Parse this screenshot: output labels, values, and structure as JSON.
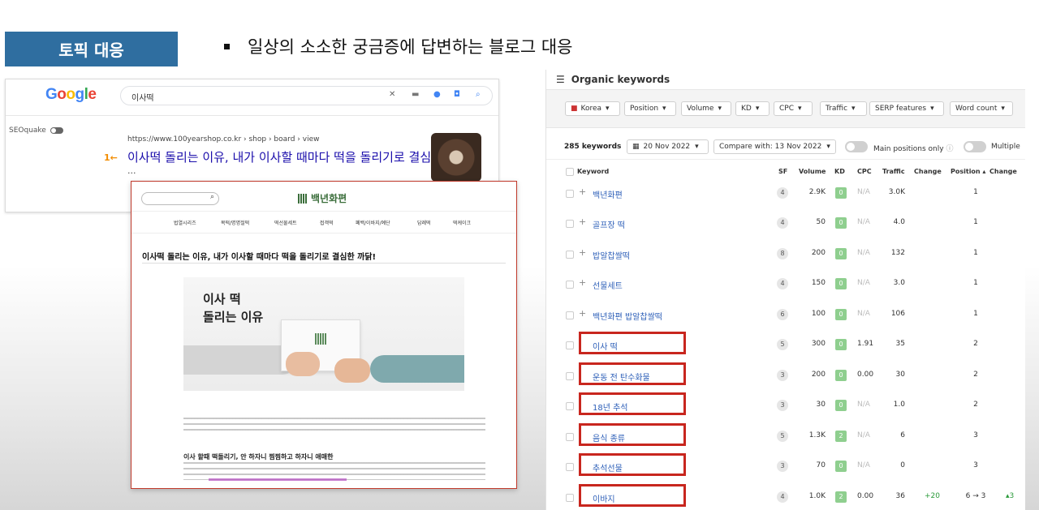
{
  "slide": {
    "topic_tag": "토픽 대응",
    "bullet": "일상의 소소한 궁금증에 답변하는 블로그 대응"
  },
  "google": {
    "logo": "Google",
    "query": "이사떡",
    "seoquake_label": "SEOquake",
    "result_url": "https://www.100yearshop.co.kr › shop › board › view",
    "result_rank": "1",
    "result_title": "이사떡 돌리는 이유, 내가 이사할 때마다 떡을 돌리기로 결심",
    "result_ellipsis": "..."
  },
  "blog": {
    "logo": "백년화편",
    "nav": [
      "법열시리즈",
      "목떡/명명절떡",
      "떡선물세트",
      "접객떡",
      "폐백/이바지/예단",
      "답례떡",
      "떡케이크"
    ],
    "title": "이사떡 돌리는 이유, 내가 이사할 때마다 떡을 돌리기로 결심한 까닭!",
    "hero_line1": "이사 떡",
    "hero_line2": "돌리는 이유",
    "subhead": "이사 할때 떡돌리기, 안 하자니 찜찜하고 하자니 애매한"
  },
  "ahrefs": {
    "title": "Organic keywords",
    "filters": [
      "Korea",
      "Position",
      "Volume",
      "KD",
      "CPC",
      "Traffic",
      "SERP features",
      "Word count"
    ],
    "keyword_count": "285 keywords",
    "date": "20 Nov 2022",
    "compare": "Compare with: 13 Nov 2022",
    "main_positions_label": "Main positions only",
    "multiple_label": "Multiple",
    "columns": {
      "keyword": "Keyword",
      "sf": "SF",
      "volume": "Volume",
      "kd": "KD",
      "cpc": "CPC",
      "traffic": "Traffic",
      "change": "Change",
      "position": "Position ▴",
      "pos_change": "Change"
    },
    "rows": [
      {
        "keyword": "백년화편",
        "sf": "4",
        "volume": "2.9K",
        "kd": "0",
        "cpc": "N/A",
        "traffic": "3.0K",
        "change": "",
        "position": "1",
        "pos_change": ""
      },
      {
        "keyword": "골프장 떡",
        "sf": "4",
        "volume": "50",
        "kd": "0",
        "cpc": "N/A",
        "traffic": "4.0",
        "change": "",
        "position": "1",
        "pos_change": ""
      },
      {
        "keyword": "밥알찹쌀떡",
        "sf": "8",
        "volume": "200",
        "kd": "0",
        "cpc": "N/A",
        "traffic": "132",
        "change": "",
        "position": "1",
        "pos_change": ""
      },
      {
        "keyword": "선물세트",
        "sf": "4",
        "volume": "150",
        "kd": "0",
        "cpc": "N/A",
        "traffic": "3.0",
        "change": "",
        "position": "1",
        "pos_change": ""
      },
      {
        "keyword": "백년화편 밥알찹쌀떡",
        "sf": "6",
        "volume": "100",
        "kd": "0",
        "cpc": "N/A",
        "traffic": "106",
        "change": "",
        "position": "1",
        "pos_change": ""
      },
      {
        "keyword": "이사 떡",
        "sf": "5",
        "volume": "300",
        "kd": "0",
        "cpc": "1.91",
        "traffic": "35",
        "change": "",
        "position": "2",
        "pos_change": ""
      },
      {
        "keyword": "운동 전 탄수화물",
        "sf": "3",
        "volume": "200",
        "kd": "0",
        "cpc": "0.00",
        "traffic": "30",
        "change": "",
        "position": "2",
        "pos_change": ""
      },
      {
        "keyword": "18년 추석",
        "sf": "3",
        "volume": "30",
        "kd": "0",
        "cpc": "N/A",
        "traffic": "1.0",
        "change": "",
        "position": "2",
        "pos_change": ""
      },
      {
        "keyword": "음식 종류",
        "sf": "5",
        "volume": "1.3K",
        "kd": "2",
        "cpc": "N/A",
        "traffic": "6",
        "change": "",
        "position": "3",
        "pos_change": ""
      },
      {
        "keyword": "추석선물",
        "sf": "3",
        "volume": "70",
        "kd": "0",
        "cpc": "N/A",
        "traffic": "0",
        "change": "",
        "position": "3",
        "pos_change": ""
      },
      {
        "keyword": "이바지",
        "sf": "4",
        "volume": "1.0K",
        "kd": "2",
        "cpc": "0.00",
        "traffic": "36",
        "change": "+20",
        "position": "6 → 3",
        "pos_change": "▴3"
      }
    ]
  },
  "colors": {
    "tag_bg": "#2f6ea0",
    "highlight_red": "#c8261e",
    "link_blue": "#1a0dab",
    "kd_green": "#8fcf8f"
  }
}
